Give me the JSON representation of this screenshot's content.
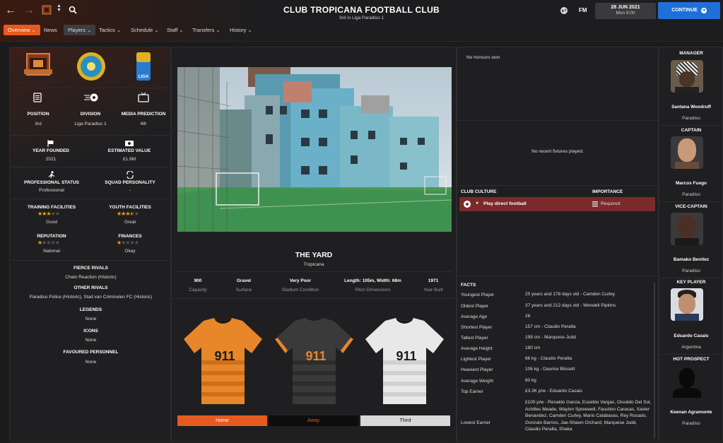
{
  "header": {
    "title": "CLUB TROPICANA FOOTBALL CLUB",
    "subtitle": "3rd in Liga Paradiso 1",
    "date": "28 JUN 2021",
    "day": "Mon 9:00",
    "continue_label": "CONTINUE",
    "fm_label": "FM"
  },
  "tabs": [
    {
      "label": "Overview ⌄"
    },
    {
      "label": "News"
    },
    {
      "label": "Players ⌄"
    },
    {
      "label": "Tactics ⌄"
    },
    {
      "label": "Schedule ⌄"
    },
    {
      "label": "Staff ⌄"
    },
    {
      "label": "Transfers ⌄"
    },
    {
      "label": "History ⌄"
    }
  ],
  "info": {
    "position_label": "POSITION",
    "position": "3rd",
    "division_label": "DIVISION",
    "division": "Liga Paradiso 1",
    "media_label": "MEDIA PREDICTION",
    "media": "4th",
    "founded_label": "YEAR FOUNDED",
    "founded": "2021",
    "value_label": "ESTIMATED VALUE",
    "value": "£1.9M",
    "pro_label": "PROFESSIONAL STATUS",
    "pro": "Professional",
    "personality_label": "SQUAD PERSONALITY",
    "personality": "-",
    "training_label": "TRAINING FACILITIES",
    "training": "Good",
    "training_stars": 3,
    "youth_label": "YOUTH FACILITIES",
    "youth": "Great",
    "youth_stars": 3.5,
    "reputation_label": "REPUTATION",
    "reputation": "National",
    "reputation_stars": 1,
    "finances_label": "FINANCES",
    "finances": "Okay",
    "finances_stars": 1,
    "fierce_label": "FIERCE RIVALS",
    "fierce": "Chain Reaction (Historic)",
    "other_label": "OTHER RIVALS",
    "other": "Paradiso Police (Historic), Stad van Criminelen FC (Historic)",
    "legends_label": "LEGENDS",
    "legends": "None",
    "icons_label": "ICONS",
    "icons": "None",
    "fav_label": "FAVOURED PERSONNEL",
    "fav": "None",
    "liga_badge_text": "LIGA"
  },
  "stadium": {
    "name": "THE YARD",
    "city": "Tropicana",
    "stats": [
      {
        "value": "900",
        "label": "Capacity"
      },
      {
        "value": "Gravel",
        "label": "Surface"
      },
      {
        "value": "Very Poor",
        "label": "Stadium Condition"
      },
      {
        "value": "Length: 105m, Width: 68m",
        "label": "Pitch Dimensions"
      },
      {
        "value": "1971",
        "label": "Year Built"
      }
    ]
  },
  "kits": {
    "home": "Home",
    "away": "Away",
    "third": "Third",
    "sponsor": "911",
    "home_color": "#e8862a",
    "away_color": "#3a3a3a",
    "third_color": "#e8e8e8"
  },
  "honours": "No honours won",
  "fixtures": "No recent fixtures played.",
  "culture": {
    "header": "CLUB CULTURE",
    "importance_header": "IMPORTANCE",
    "item": "Play direct football",
    "importance": "Required"
  },
  "facts": {
    "header": "FACTS",
    "rows": [
      {
        "label": "Youngest Player",
        "value": "20 years and 178 days old - Camden Curley"
      },
      {
        "label": "Oldest Player",
        "value": "37 years and 212 days old - Wendell Pipkins"
      },
      {
        "label": "Average Age",
        "value": "26"
      },
      {
        "label": "Shortest Player",
        "value": "157 cm - Claudio Peralta"
      },
      {
        "label": "Tallest Player",
        "value": "199 cm - Marquese Judd"
      },
      {
        "label": "Average Height",
        "value": "180 cm"
      },
      {
        "label": "Lightest Player",
        "value": "66 kg - Claudio Peralta"
      },
      {
        "label": "Heaviest Player",
        "value": "106 kg - Daurice Blissett"
      },
      {
        "label": "Average Weight",
        "value": "80 kg"
      },
      {
        "label": "Top Earner",
        "value": "£3.3K p/w - Eduardo Casais"
      },
      {
        "label": "Lowest Earner",
        "value": "£100 p/w - Renaldo Garcia, Eusebio Vargas, Osvaldo Del Sol, Achilles Meade, Waylon Spreewell, Faustino Caracas, Xavier Benavidez, Camden Curley, Mario Calabasas, Rey Rosado, Gonzalo Barrios, Jae-Shawn Orchard, Marquese Judd, Claudio Peralta, Shaka"
      }
    ]
  },
  "staff": [
    {
      "role": "MANAGER",
      "name": "Santana Woodruff",
      "nat": "Paradiso"
    },
    {
      "role": "CAPTAIN",
      "name": "Marcos Fuego",
      "nat": "Paradiso"
    },
    {
      "role": "VICE-CAPTAIN",
      "name": "Bamako Benitez",
      "nat": "Paradiso"
    },
    {
      "role": "KEY PLAYER",
      "name": "Eduardo Casais",
      "nat": "Argentina"
    },
    {
      "role": "HOT PROSPECT",
      "name": "Keenan Agramonte",
      "nat": "Paradiso"
    }
  ]
}
